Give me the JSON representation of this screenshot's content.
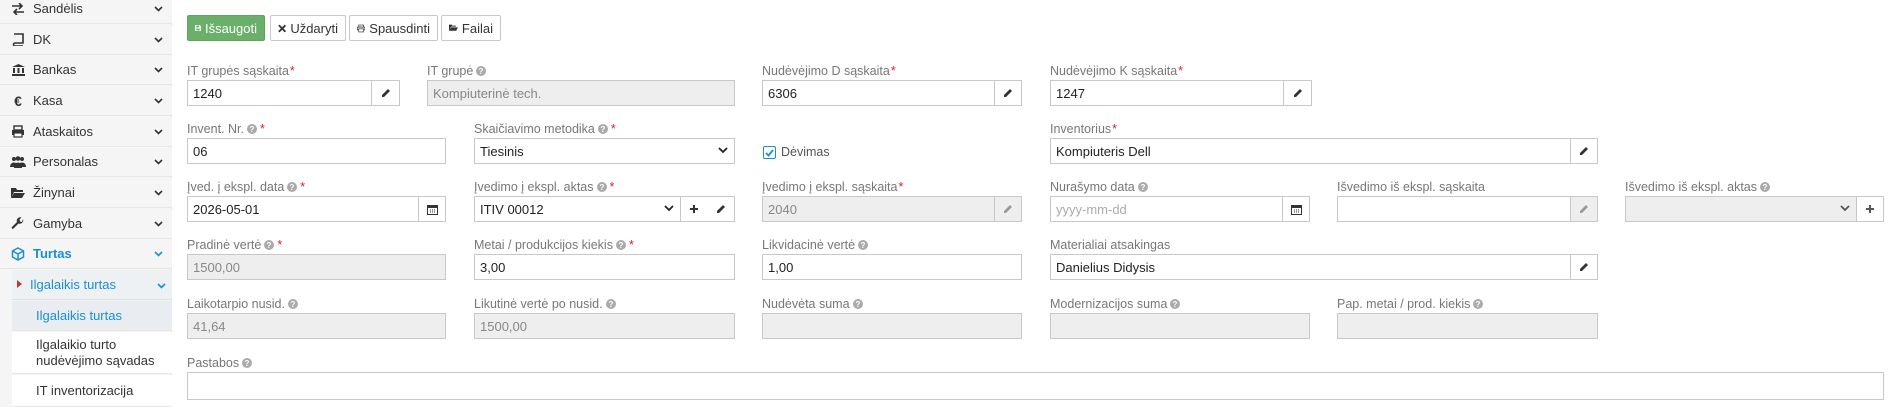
{
  "sidebar": {
    "items": [
      {
        "label": "Sandėlis",
        "icon": "exchange-icon"
      },
      {
        "label": "DK",
        "icon": "book-icon"
      },
      {
        "label": "Bankas",
        "icon": "bank-icon"
      },
      {
        "label": "Kasa",
        "icon": "euro-icon"
      },
      {
        "label": "Ataskaitos",
        "icon": "print-icon"
      },
      {
        "label": "Personalas",
        "icon": "users-icon"
      },
      {
        "label": "Žinynai",
        "icon": "folder-open-icon"
      },
      {
        "label": "Gamyba",
        "icon": "wrench-icon"
      },
      {
        "label": "Turtas",
        "icon": "cube-icon"
      }
    ],
    "submenu": {
      "label": "Ilgalaikis turtas"
    },
    "leaves": [
      {
        "label": "Ilgalaikis turtas"
      },
      {
        "label": "Ilgalaikio turto nudėvėjimo sąvadas"
      },
      {
        "label": "IT inventorizacija"
      }
    ]
  },
  "toolbar": {
    "save": "Išsaugoti",
    "close": "Uždaryti",
    "print": "Spausdinti",
    "files": "Failai"
  },
  "form": {
    "it_group_account": {
      "label": "IT grupės sąskaita",
      "value": "1240"
    },
    "it_group": {
      "label": "IT grupė",
      "value": "Kompiuterinė tech."
    },
    "depr_d_account": {
      "label": "Nudėvėjimo D sąskaita",
      "value": "6306"
    },
    "depr_k_account": {
      "label": "Nudėvėjimo K sąskaita",
      "value": "1247"
    },
    "invent_nr": {
      "label": "Invent. Nr.",
      "value": "06"
    },
    "calc_method": {
      "label": "Skaičiavimo metodika",
      "value": "Tiesinis"
    },
    "depreciating": {
      "label": "Dėvimas",
      "checked": true
    },
    "inventory": {
      "label": "Inventorius",
      "value": "Kompiuteris Dell"
    },
    "commission_date": {
      "label": "Įved. į ekspl. data",
      "value": "2026-05-01"
    },
    "commission_act": {
      "label": "Įvedimo į ekspl. aktas",
      "value": "ITIV 00012"
    },
    "commission_account": {
      "label": "Įvedimo į ekspl. sąskaita",
      "value": "2040"
    },
    "writeoff_date": {
      "label": "Nurašymo data",
      "placeholder": "yyyy-mm-dd"
    },
    "decommission_account": {
      "label": "Išvedimo iš ekspl. sąskaita",
      "value": ""
    },
    "decommission_act": {
      "label": "Išvedimo iš ekspl. aktas",
      "value": ""
    },
    "initial_value": {
      "label": "Pradinė vertė",
      "value": "1500,00"
    },
    "years_qty": {
      "label": "Metai / produkcijos kiekis",
      "value": "3,00"
    },
    "liquidation_value": {
      "label": "Likvidacinė vertė",
      "value": "1,00"
    },
    "responsible": {
      "label": "Materialiai atsakingas",
      "value": "Danielius Didysis"
    },
    "period_depr": {
      "label": "Laikotarpio nusid.",
      "value": "41,64"
    },
    "residual_value": {
      "label": "Likutinė vertė po nusid.",
      "value": "1500,00"
    },
    "depr_sum": {
      "label": "Nudėvėta suma",
      "value": ""
    },
    "modern_sum": {
      "label": "Modernizacijos suma",
      "value": ""
    },
    "extra_years": {
      "label": "Pap. metai / prod. kiekis",
      "value": ""
    },
    "notes": {
      "label": "Pastabos",
      "value": ""
    }
  },
  "colors": {
    "accent": "#1a8fd1",
    "save_button": "#6ab06a",
    "required": "#e02020"
  }
}
